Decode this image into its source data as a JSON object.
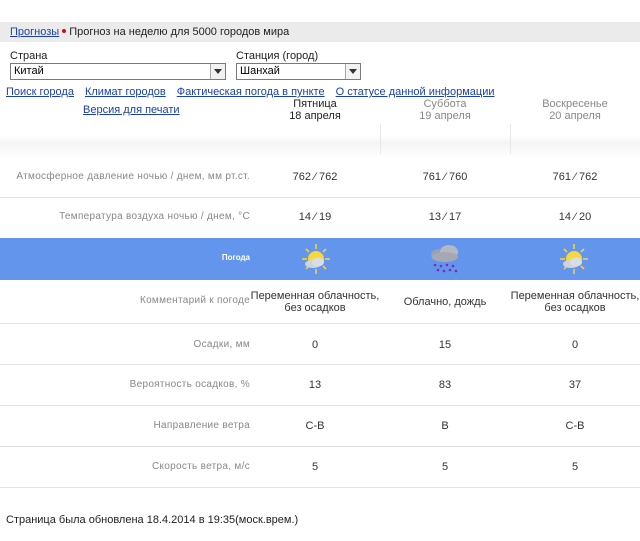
{
  "breadcrumb": {
    "link": "Прогнозы",
    "title": "Прогноз на неделю для 5000 городов мира"
  },
  "country": {
    "label": "Страна",
    "value": "Китай"
  },
  "station": {
    "label": "Станция (город)",
    "value": "Шанхай"
  },
  "links": [
    "Поиск города",
    "Климат городов",
    "Фактическая погода в пункте",
    "О статусе данной информации"
  ],
  "print_link": "Версия для печати",
  "days": [
    {
      "name": "Пятница",
      "date": "18 апреля"
    },
    {
      "name": "Суббота",
      "date": "19 апреля"
    },
    {
      "name": "Воскресенье",
      "date": "20 апреля"
    }
  ],
  "rows": {
    "pressure": {
      "label": "Атмосферное давление ночью / днем, мм рт.ст.",
      "values": [
        "762 ⁄ 762",
        "761 ⁄ 760",
        "761 ⁄ 762"
      ]
    },
    "temperature": {
      "label": "Температура воздуха ночью / днем, °С",
      "values": [
        "14 ⁄ 19",
        "13 ⁄ 17",
        "14 ⁄ 20"
      ]
    },
    "weather": {
      "label": "Погода",
      "icons": [
        "sun-cloud-icon",
        "rain-cloud-icon",
        "sun-cloud-icon"
      ]
    },
    "comment": {
      "label": "Комментарий к погоде",
      "values": [
        [
          "Переменная облачность,",
          "без осадков"
        ],
        [
          "Облачно, дождь",
          ""
        ],
        [
          "Переменная облачность,",
          "без осадков"
        ]
      ]
    },
    "precipitation": {
      "label": "Осадки, мм",
      "values": [
        "0",
        "15",
        "0"
      ]
    },
    "probability": {
      "label": "Вероятность осадков, %",
      "values": [
        "13",
        "83",
        "37"
      ]
    },
    "wind_dir": {
      "label": "Направление ветра",
      "values": [
        "С-В",
        "В",
        "С-В"
      ]
    },
    "wind_speed": {
      "label": "Скорость ветра, м/с",
      "values": [
        "5",
        "5",
        "5"
      ]
    }
  },
  "footer": "Страница была обновлена 18.4.2014 в 19:35(моск.врем.)",
  "colors": {
    "weather_band": "#6495ec",
    "link": "#1a3fb0"
  }
}
